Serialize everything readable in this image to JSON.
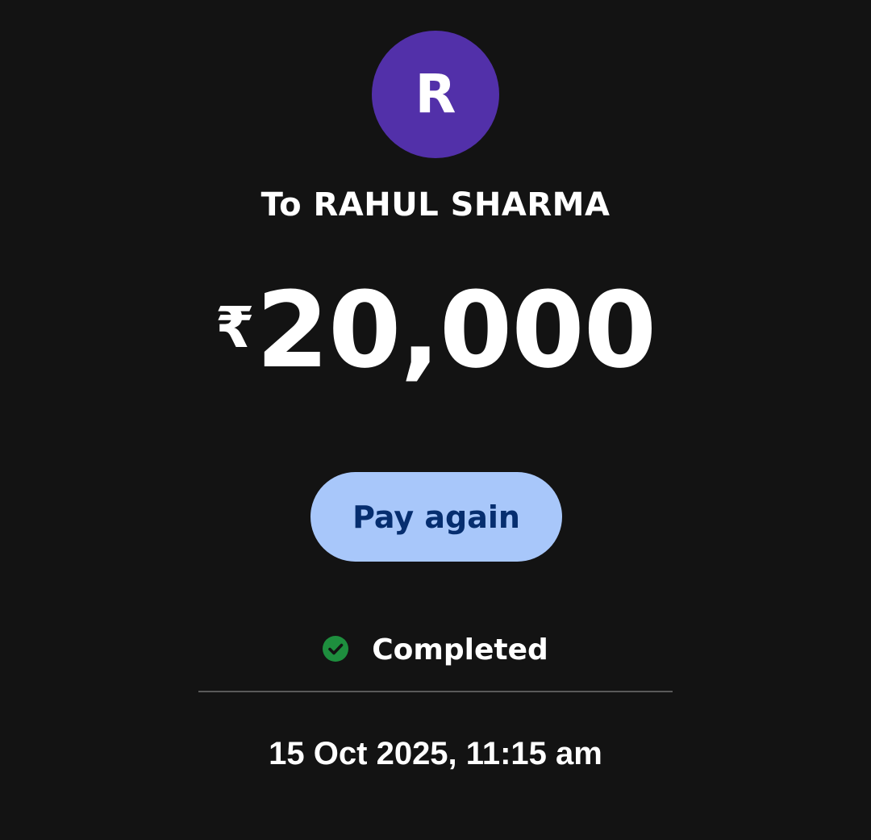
{
  "payee": {
    "avatar_initial": "R",
    "avatar_color": "#5230a9",
    "label": "To RAHUL SHARMA"
  },
  "payment": {
    "currency_symbol": "₹",
    "amount": "20,000"
  },
  "actions": {
    "pay_again_label": "Pay again",
    "pay_again_color": "#a8c7fa"
  },
  "status": {
    "icon": "check-circle-icon",
    "icon_color": "#1e8e3e",
    "text": "Completed"
  },
  "timestamp": "15 Oct 2025, 11:15 am"
}
